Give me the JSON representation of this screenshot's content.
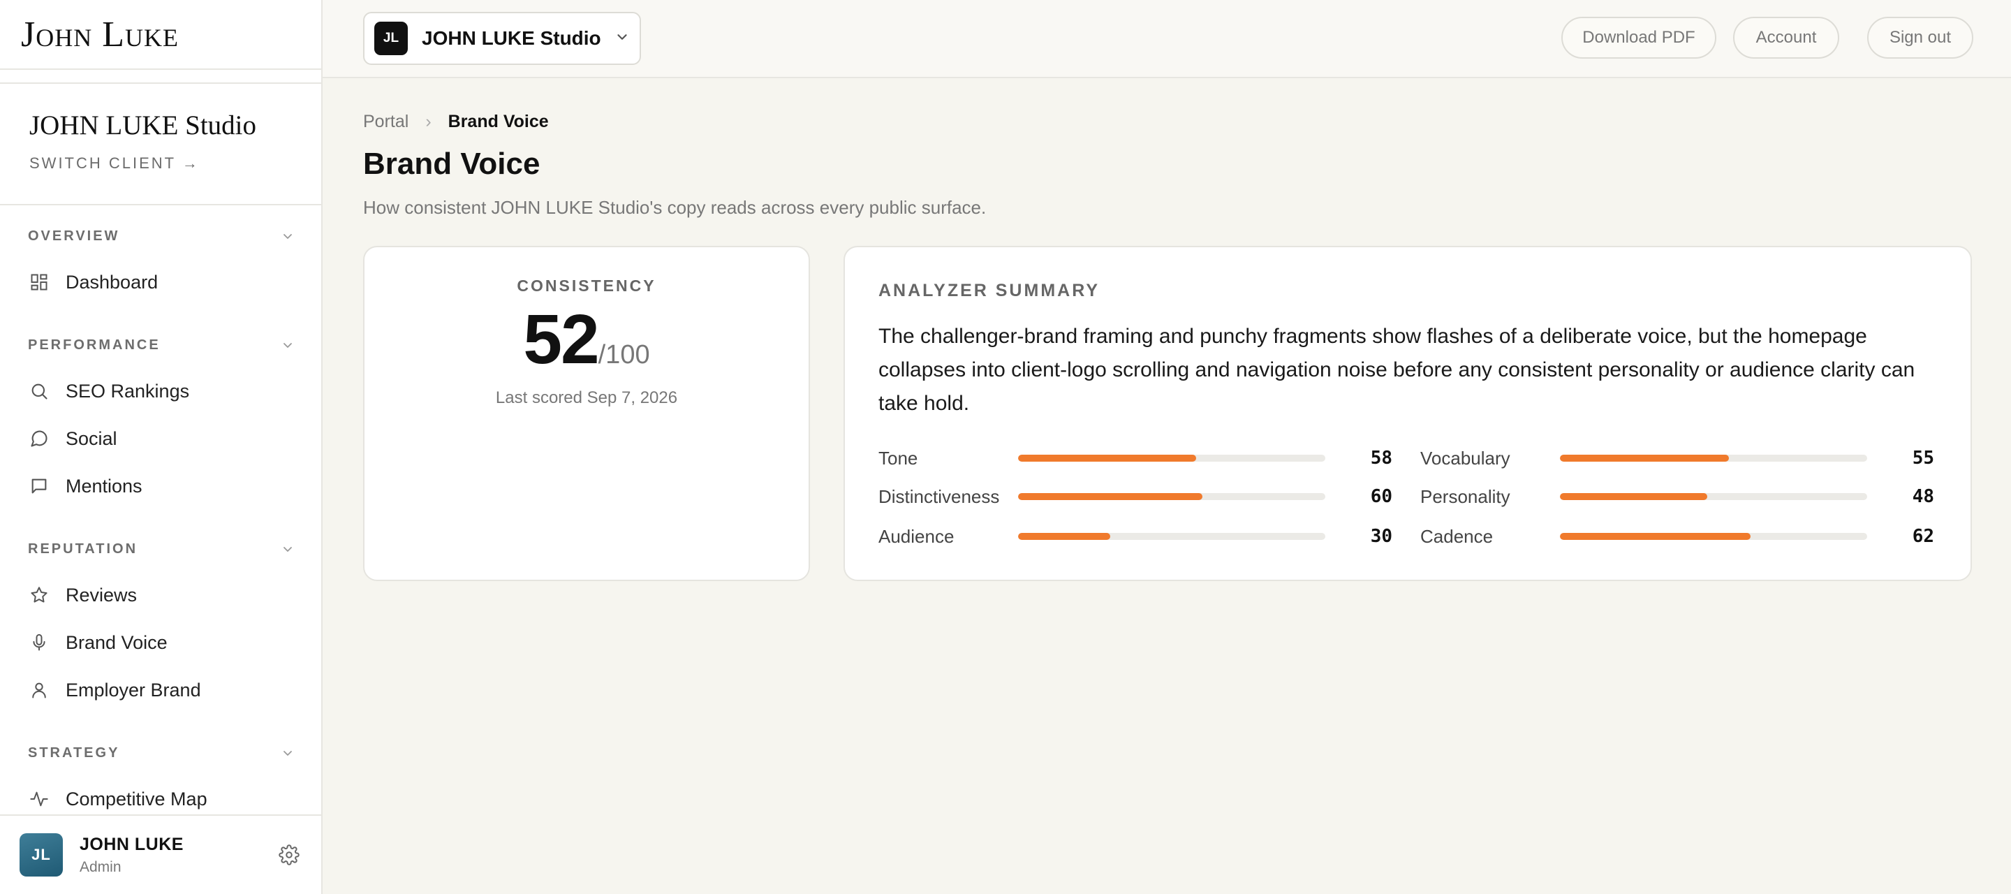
{
  "brand": {
    "logo_text": "John Luke"
  },
  "client": {
    "name": "JOHN LUKE Studio",
    "switch_label": "SWITCH CLIENT →",
    "initials": "JL"
  },
  "nav": {
    "sections": [
      {
        "title": "OVERVIEW",
        "items": [
          {
            "label": "Dashboard",
            "icon": "grid-icon"
          }
        ]
      },
      {
        "title": "PERFORMANCE",
        "items": [
          {
            "label": "SEO Rankings",
            "icon": "search-icon"
          },
          {
            "label": "Social",
            "icon": "chat-bubble-icon"
          },
          {
            "label": "Mentions",
            "icon": "message-square-icon"
          }
        ]
      },
      {
        "title": "REPUTATION",
        "items": [
          {
            "label": "Reviews",
            "icon": "star-icon"
          },
          {
            "label": "Brand Voice",
            "icon": "microphone-icon"
          },
          {
            "label": "Employer Brand",
            "icon": "user-icon"
          }
        ]
      },
      {
        "title": "STRATEGY",
        "items": [
          {
            "label": "Competitive Map",
            "icon": "activity-icon"
          }
        ]
      }
    ]
  },
  "user": {
    "initials": "JL",
    "name": "JOHN LUKE",
    "role": "Admin"
  },
  "topbar": {
    "client_initials": "JL",
    "client_name": "JOHN LUKE Studio",
    "download_label": "Download PDF",
    "account_label": "Account",
    "signout_label": "Sign out"
  },
  "breadcrumb": {
    "root": "Portal",
    "separator": "›",
    "current": "Brand Voice"
  },
  "page": {
    "title": "Brand Voice",
    "subtitle": "How consistent JOHN LUKE Studio's copy reads across every public surface."
  },
  "consistency": {
    "label": "CONSISTENCY",
    "score": "52",
    "max": "/100",
    "date": "Last scored Sep 7, 2026"
  },
  "summary": {
    "label": "ANALYZER SUMMARY",
    "text": "The challenger-brand framing and punchy fragments show flashes of a deliberate voice, but the homepage collapses into client-logo scrolling and navigation noise before any consistent personality or audience clarity can take hold.",
    "metrics": [
      {
        "label": "Tone",
        "value": "58"
      },
      {
        "label": "Vocabulary",
        "value": "55"
      },
      {
        "label": "Distinctiveness",
        "value": "60"
      },
      {
        "label": "Personality",
        "value": "48"
      },
      {
        "label": "Audience",
        "value": "30"
      },
      {
        "label": "Cadence",
        "value": "62"
      }
    ]
  },
  "colors": {
    "accent": "#f07a2c",
    "sidebar_bg": "#ffffff",
    "page_bg": "#f6f5ef"
  }
}
